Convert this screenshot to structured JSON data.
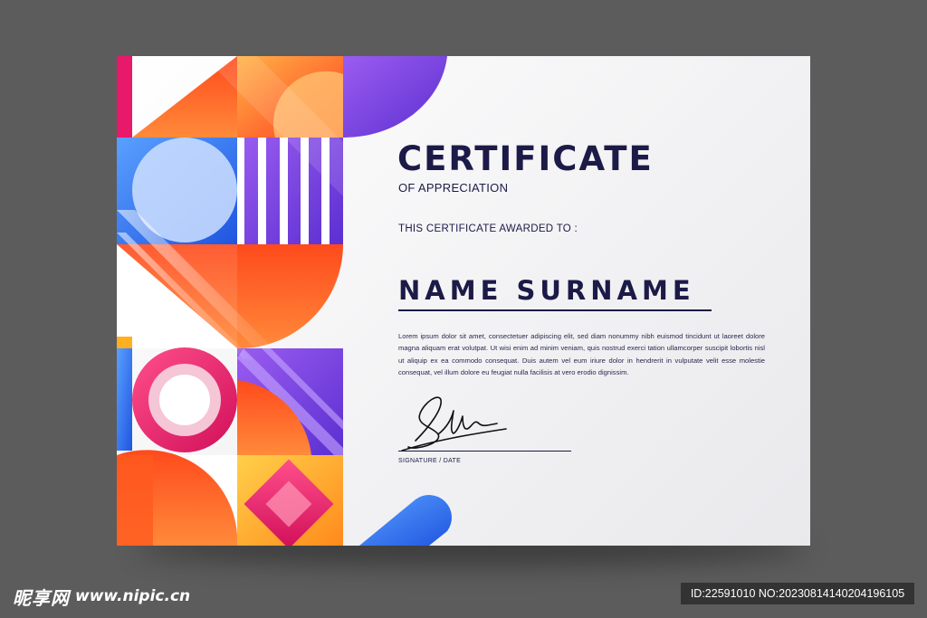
{
  "certificate": {
    "title": "CERTIFICATE",
    "subtitle": "OF APPRECIATION",
    "awarded_to": "THIS CERTIFICATE AWARDED TO :",
    "recipient_name": "NAME SURNAME",
    "body_text": "Lorem ipsum dolor sit amet, consectetuer adipiscing elit, sed diam nonummy nibh euismod tincidunt ut laoreet dolore magna aliquam erat volutpat. Ut wisi enim ad minim veniam, quis nostrud exerci tation ullamcorper suscipit lobortis nisl ut aliquip ex ea commodo consequat. Duis autem vel eum iriure dolor in hendrerit in vulputate velit esse molestie consequat, vel illum dolore eu feugiat nulla facilisis at vero erodio dignissim.",
    "signature_label": "SIGNATURE / DATE",
    "colors": {
      "text": "#1c1a47",
      "orange": "#ff5a1f",
      "purple": "#7a3de0",
      "pink": "#e8186b",
      "blue": "#2a6be8",
      "yellow": "#ffb020",
      "background": "#f1f1f3"
    }
  },
  "watermark": {
    "site_name": "昵享网",
    "site_url": "www.nipic.cn",
    "id_text": "ID:22591010 NO:20230814140204196105"
  }
}
